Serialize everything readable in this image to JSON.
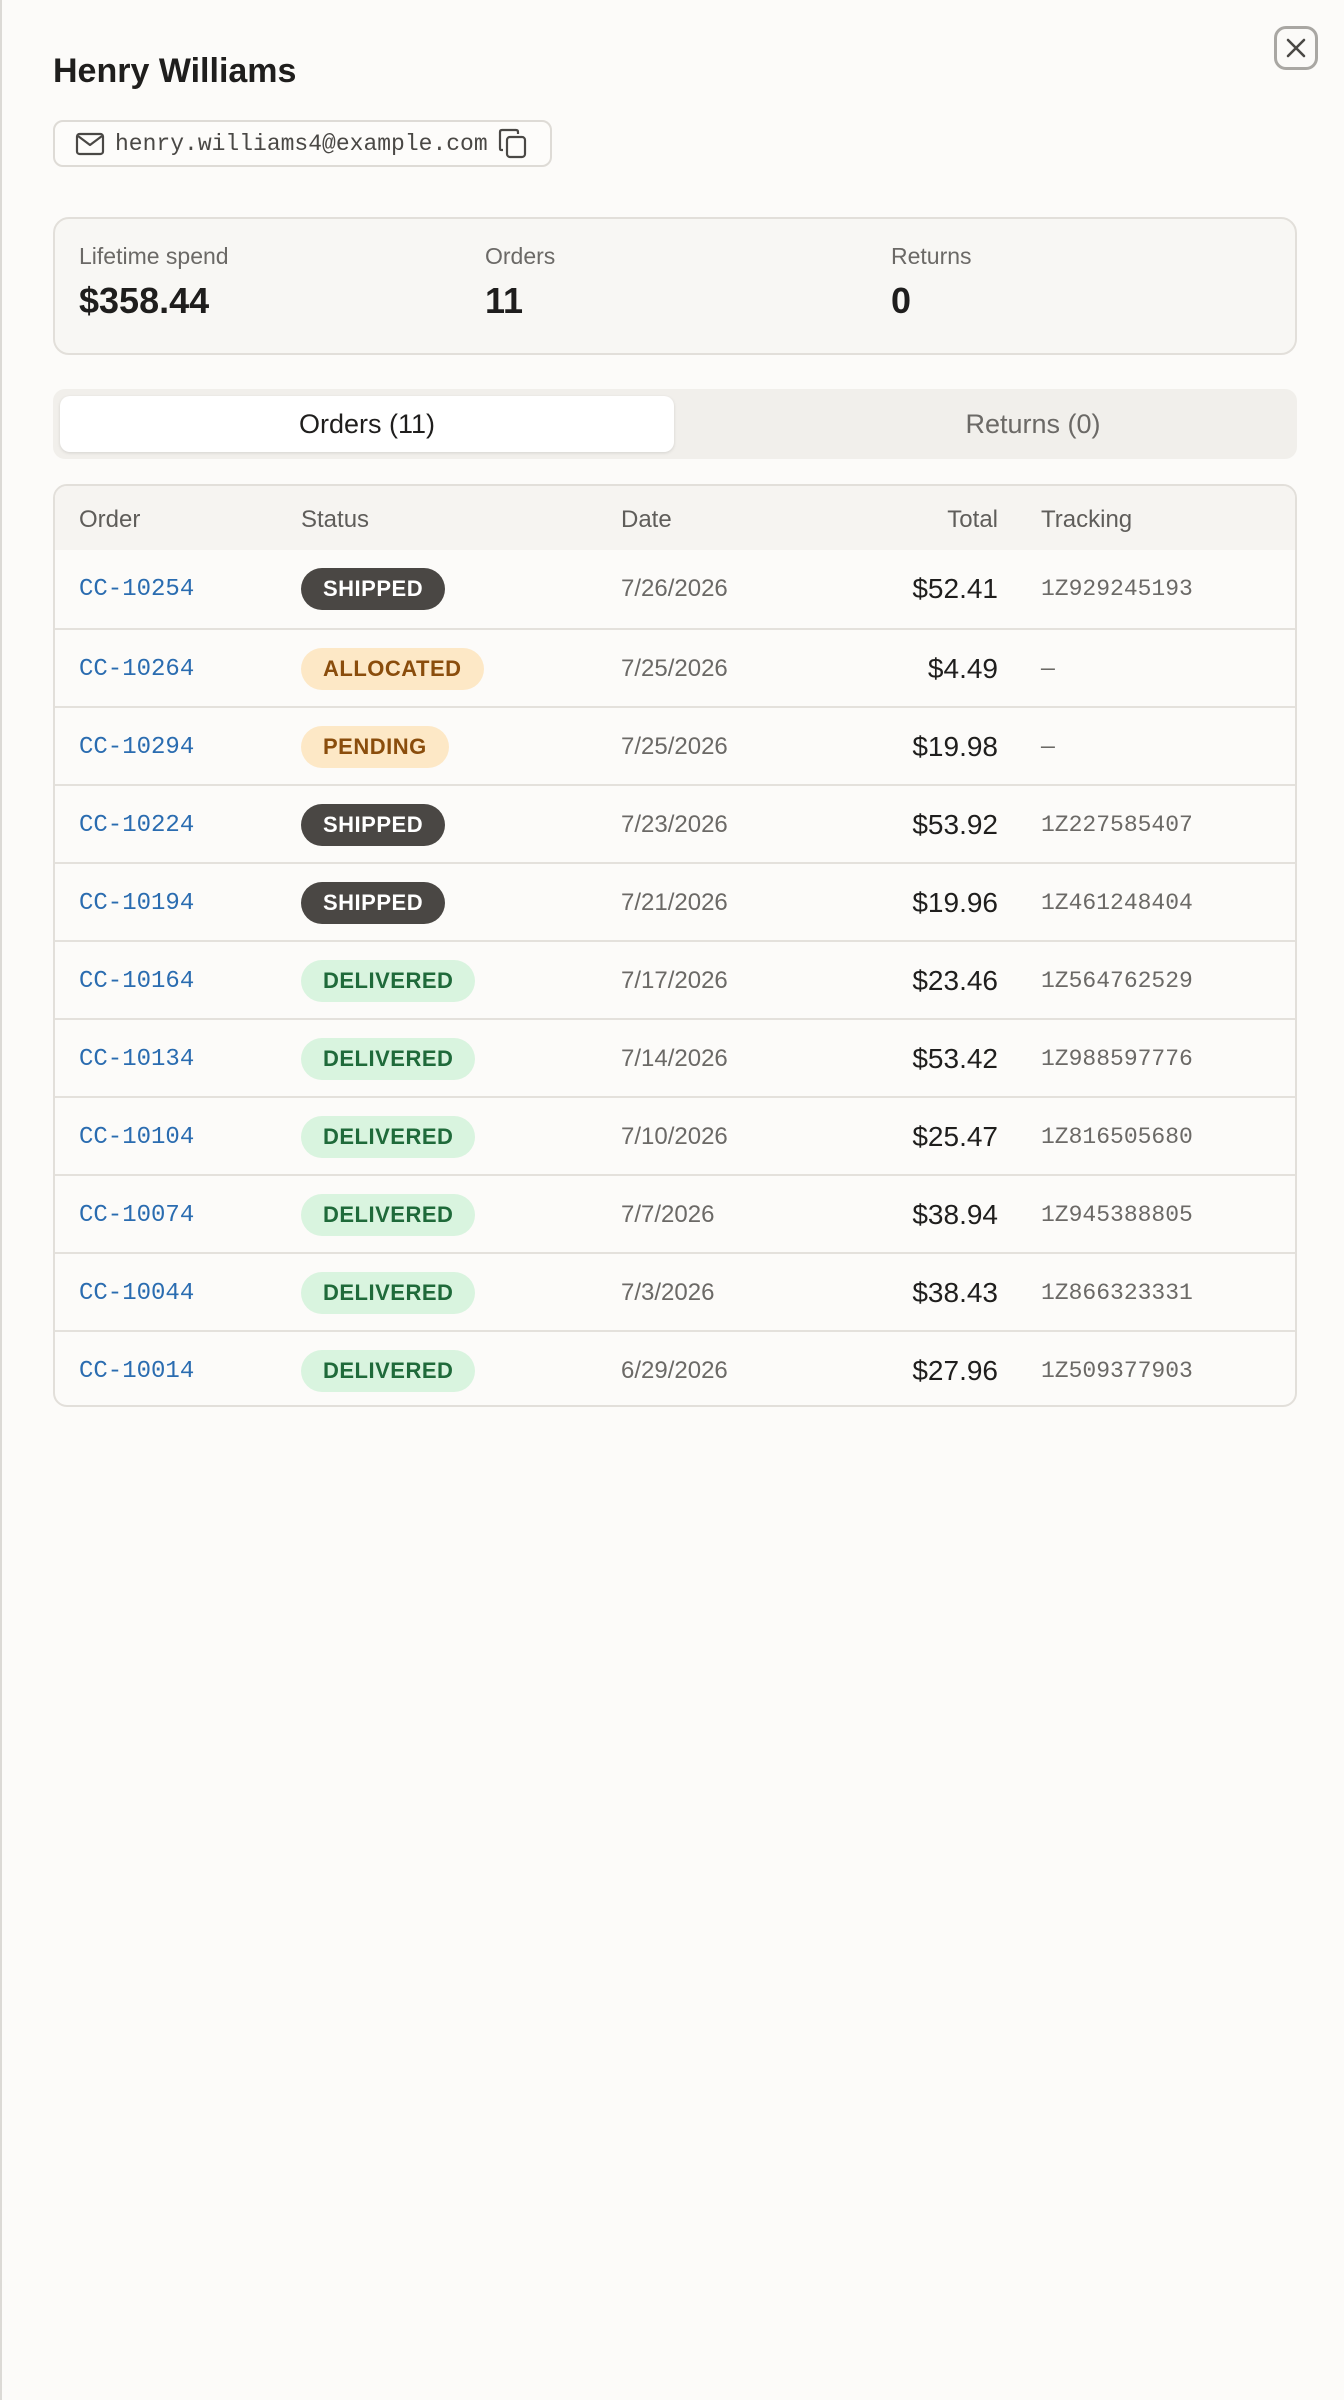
{
  "customer": {
    "name": "Henry Williams",
    "email": "henry.williams4@example.com"
  },
  "stats": {
    "lifetime_spend_label": "Lifetime spend",
    "lifetime_spend_value": "$358.44",
    "orders_label": "Orders",
    "orders_value": "11",
    "returns_label": "Returns",
    "returns_value": "0"
  },
  "tabs": {
    "orders": "Orders (11)",
    "returns": "Returns (0)"
  },
  "table": {
    "headers": {
      "order": "Order",
      "status": "Status",
      "date": "Date",
      "total": "Total",
      "tracking": "Tracking"
    },
    "rows": [
      {
        "order": "CC-10254",
        "status": "SHIPPED",
        "status_kind": "shipped",
        "date": "7/26/2026",
        "total": "$52.41",
        "tracking": "1Z929245193"
      },
      {
        "order": "CC-10264",
        "status": "ALLOCATED",
        "status_kind": "allocated",
        "date": "7/25/2026",
        "total": "$4.49",
        "tracking": "—"
      },
      {
        "order": "CC-10294",
        "status": "PENDING",
        "status_kind": "pending",
        "date": "7/25/2026",
        "total": "$19.98",
        "tracking": "—"
      },
      {
        "order": "CC-10224",
        "status": "SHIPPED",
        "status_kind": "shipped",
        "date": "7/23/2026",
        "total": "$53.92",
        "tracking": "1Z227585407"
      },
      {
        "order": "CC-10194",
        "status": "SHIPPED",
        "status_kind": "shipped",
        "date": "7/21/2026",
        "total": "$19.96",
        "tracking": "1Z461248404"
      },
      {
        "order": "CC-10164",
        "status": "DELIVERED",
        "status_kind": "delivered",
        "date": "7/17/2026",
        "total": "$23.46",
        "tracking": "1Z564762529"
      },
      {
        "order": "CC-10134",
        "status": "DELIVERED",
        "status_kind": "delivered",
        "date": "7/14/2026",
        "total": "$53.42",
        "tracking": "1Z988597776"
      },
      {
        "order": "CC-10104",
        "status": "DELIVERED",
        "status_kind": "delivered",
        "date": "7/10/2026",
        "total": "$25.47",
        "tracking": "1Z816505680"
      },
      {
        "order": "CC-10074",
        "status": "DELIVERED",
        "status_kind": "delivered",
        "date": "7/7/2026",
        "total": "$38.94",
        "tracking": "1Z945388805"
      },
      {
        "order": "CC-10044",
        "status": "DELIVERED",
        "status_kind": "delivered",
        "date": "7/3/2026",
        "total": "$38.43",
        "tracking": "1Z866323331"
      },
      {
        "order": "CC-10014",
        "status": "DELIVERED",
        "status_kind": "delivered",
        "date": "6/29/2026",
        "total": "$27.96",
        "tracking": "1Z509377903"
      }
    ]
  },
  "icons": {
    "close": "close-icon",
    "mail": "mail-icon",
    "copy": "copy-icon"
  }
}
